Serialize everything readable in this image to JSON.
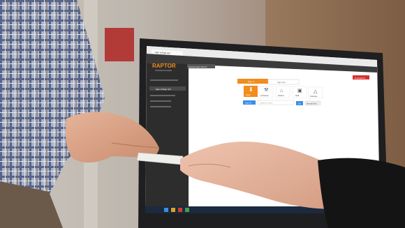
{
  "app": {
    "logo_main": "RAPTOR",
    "logo_sub": "TECHNOLOGIES",
    "tab_title": "Sign In/Sign Out",
    "school": "Sandia High School"
  },
  "sidebar": {
    "items": [
      {
        "label": "Sign In/Sign Out"
      }
    ]
  },
  "main": {
    "mode_tabs": [
      "Sign In",
      "Sign Out"
    ],
    "person_types": [
      "Visitor",
      "Contractor",
      "Student",
      "Staff",
      "Volunteer"
    ],
    "search_button": "Scan ID",
    "search_placeholder": "Search by name",
    "go_button": "Go",
    "quick_button": "Manual Entry",
    "alert_button": "Emergency"
  },
  "colors": {
    "accent": "#f28c1c",
    "blue": "#3a8ee6",
    "emergency": "#d9302c",
    "sidebar": "#2d2d2d"
  }
}
